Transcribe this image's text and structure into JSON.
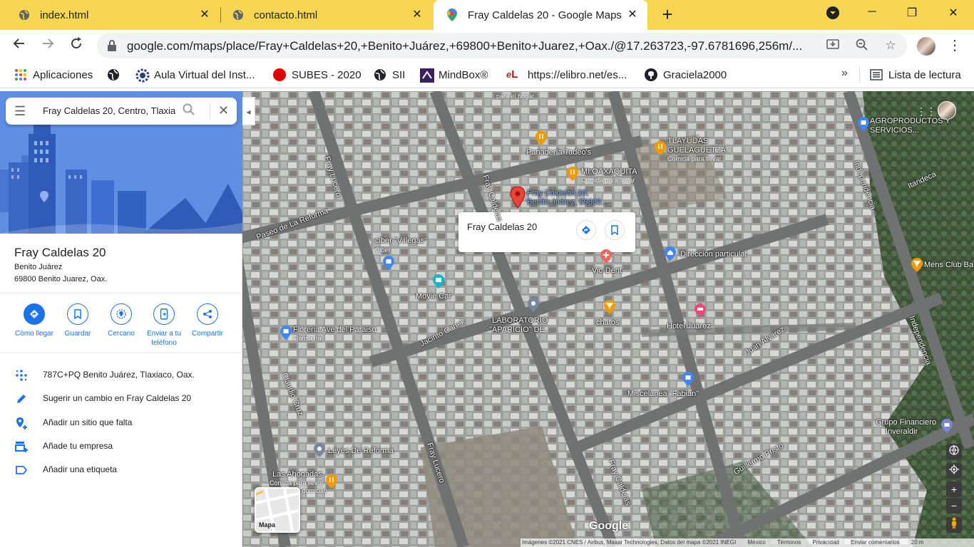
{
  "browser": {
    "tabs": [
      {
        "title": "index.html",
        "icon": "globe-icon"
      },
      {
        "title": "contacto.html",
        "icon": "globe-icon"
      },
      {
        "title": "Fray Caldelas 20 - Google Maps",
        "icon": "maps-pin-icon"
      }
    ],
    "active_tab": 2,
    "url": "google.com/maps/place/Fray+Caldelas+20,+Benito+Juárez,+69800+Benito+Juarez,+Oax./@17.263723,-97.6781696,256m/...",
    "bookmarks": [
      {
        "label": "Aplicaciones",
        "icon": "apps-grid-icon"
      },
      {
        "label": "",
        "icon": "globe-icon"
      },
      {
        "label": "Aula Virtual del Inst...",
        "icon": "gear-logo-icon"
      },
      {
        "label": "SUBES - 2020",
        "icon": "red-circle-icon"
      },
      {
        "label": "SII",
        "icon": "globe-icon"
      },
      {
        "label": "MindBox®",
        "icon": "mindbox-icon"
      },
      {
        "label": "https://elibro.net/es...",
        "icon": "elibro-icon"
      },
      {
        "label": "Graciela2000",
        "icon": "github-icon"
      }
    ],
    "more_bookmarks": "»",
    "reading_list": "Lista de lectura",
    "accent": "#f7d652"
  },
  "panel": {
    "search_value": "Fray Caldelas 20, Centro, Tlaxiaco",
    "place_title": "Fray Caldelas 20",
    "address_line1": "Benito Juárez",
    "address_line2": "69800 Benito Juarez, Oax.",
    "actions": [
      {
        "label": "Cómo llegar",
        "icon": "directions-icon"
      },
      {
        "label": "Guardar",
        "icon": "bookmark-icon"
      },
      {
        "label": "Cercano",
        "icon": "nearby-icon"
      },
      {
        "label": "Enviar a tu teléfono",
        "icon": "send-to-phone-icon"
      },
      {
        "label": "Compartir",
        "icon": "share-icon"
      }
    ],
    "info": [
      {
        "text": "787C+PQ Benito Juárez, Tlaxiaco, Oax.",
        "icon": "plus-code-icon"
      },
      {
        "text": "Sugerir un cambio en Fray Caldelas 20",
        "icon": "pencil-icon"
      },
      {
        "text": "Añadir un sitio que falta",
        "icon": "add-place-icon"
      },
      {
        "text": "Añade tu empresa",
        "icon": "add-business-icon"
      },
      {
        "text": "Añadir una etiqueta",
        "icon": "label-icon"
      }
    ]
  },
  "map": {
    "infocard_title": "Fray Caldelas 20",
    "selected_label_1": "Fray Caldelas 20,",
    "selected_label_2": "Benito Juárez, 69800...",
    "places": [
      {
        "name": "para el hogar"
      },
      {
        "name": "Panadería Tadeo's"
      },
      {
        "name": "TLAYUDAS",
        "sub": "GUELAGUETZA",
        "sub2": "Comida para llevar"
      },
      {
        "name": "MI OAXAQUITA",
        "sub": "Comida para llevar"
      },
      {
        "name": "AGROPRODUCTOS Y",
        "sub": "SERVICIOS..."
      },
      {
        "name": "ciber \"Villegas\"",
        "sub": "Ciber"
      },
      {
        "name": "Movie Car"
      },
      {
        "name": "Vic-Dent"
      },
      {
        "name": "Dirección particular"
      },
      {
        "name": "Mens Club Ba"
      },
      {
        "name": "LABORATORIO",
        "sub": "\"APARICIO\" DE..."
      },
      {
        "name": "chatos"
      },
      {
        "name": "Hotel Juárez"
      },
      {
        "name": "Floreria Ave del Paraiso",
        "sub": "Floristeria"
      },
      {
        "name": "Miscelanea \"Fabian\""
      },
      {
        "name": "Grupo Financiero",
        "sub": "Inveraldir"
      },
      {
        "name": "Leyes De Reforma"
      },
      {
        "name": "Las Ahogadas",
        "sub": "Comida para llevar",
        "sub2": "Entrega a domicilio"
      }
    ],
    "roads": [
      "Fray Lucero",
      "Paseo de La Reforma",
      "Fray Caldelas",
      "Independencia",
      "Itandeca",
      "Jacinto Canek",
      "Juan Álvarez",
      "Claudio Cruz",
      "Fray Lucero",
      "Fray Caldelas",
      "Guillermo Pristo",
      "Independencia"
    ],
    "layer_label": "Mapa",
    "logo": "Google",
    "attribution": [
      "Imágenes ©2021 CNES / Airbus, Maxar Technologies, Datos del mapa ©2021 INEGI",
      "México",
      "Términos",
      "Privacidad",
      "Enviar comentarios",
      "20 m"
    ]
  }
}
